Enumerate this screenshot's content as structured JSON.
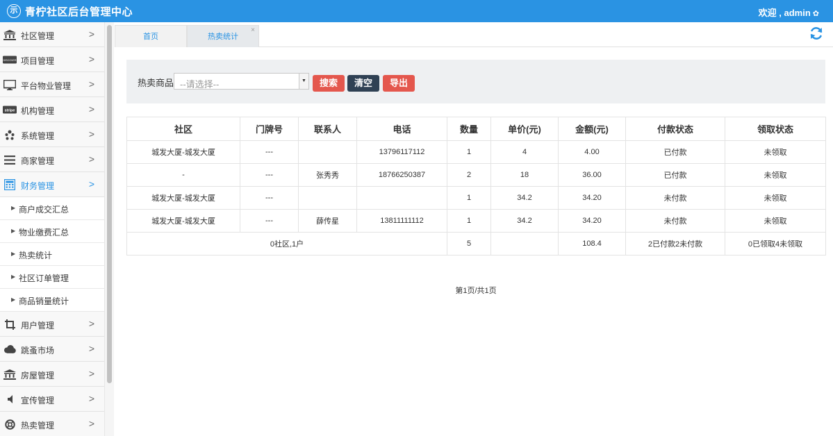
{
  "header": {
    "logo_glyph": "示",
    "title": "青柠社区后台管理中心",
    "welcome": "欢迎 , admin",
    "brand_color": "#2a93e3"
  },
  "sidebar": {
    "items": [
      {
        "label": "社区管理",
        "icon": "bank-icon"
      },
      {
        "label": "项目管理",
        "icon": "discover-card-icon"
      },
      {
        "label": "平台物业管理",
        "icon": "desktop-icon"
      },
      {
        "label": "机构管理",
        "icon": "stripe-icon"
      },
      {
        "label": "系统管理",
        "icon": "yelp-icon"
      },
      {
        "label": "商家管理",
        "icon": "bars-icon"
      },
      {
        "label": "财务管理",
        "icon": "calculator-icon"
      },
      {
        "label": "用户管理",
        "icon": "crop-icon"
      },
      {
        "label": "跳蚤市场",
        "icon": "cloud-icon"
      },
      {
        "label": "房屋管理",
        "icon": "bank-icon"
      },
      {
        "label": "宣传管理",
        "icon": "volume-icon"
      },
      {
        "label": "热卖管理",
        "icon": "life-ring-icon"
      }
    ],
    "sub_items": [
      "商户成交汇总",
      "物业缴费汇总",
      "热卖统计",
      "社区订单管理",
      "商品销量统计"
    ],
    "stripe_text": "stripe",
    "discover_text": "DISCOVER"
  },
  "tabs": [
    {
      "label": "首页"
    },
    {
      "label": "热卖统计"
    }
  ],
  "filter": {
    "label": "热卖商品",
    "placeholder": "--请选择--",
    "search": "搜索",
    "clear": "清空",
    "export": "导出"
  },
  "table": {
    "headers": [
      "社区",
      "门牌号",
      "联系人",
      "电话",
      "数量",
      "单价(元)",
      "金额(元)",
      "付款状态",
      "领取状态"
    ],
    "rows": [
      [
        "城发大厦-城发大厦",
        "---",
        "",
        "13796117112",
        "1",
        "4",
        "4.00",
        "已付款",
        "未领取"
      ],
      [
        "-",
        "---",
        "张秀秀",
        "18766250387",
        "2",
        "18",
        "36.00",
        "已付款",
        "未领取"
      ],
      [
        "城发大厦-城发大厦",
        "---",
        "",
        "",
        "1",
        "34.2",
        "34.20",
        "未付款",
        "未领取"
      ],
      [
        "城发大厦-城发大厦",
        "---",
        "薛传星",
        "13811111112",
        "1",
        "34.2",
        "34.20",
        "未付款",
        "未领取"
      ]
    ],
    "summary": {
      "community": "0社区,1户",
      "qty": "5",
      "amount": "108.4",
      "pay": "2已付款2未付款",
      "pickup": "0已领取4未领取"
    }
  },
  "pager": "第1页/共1页"
}
